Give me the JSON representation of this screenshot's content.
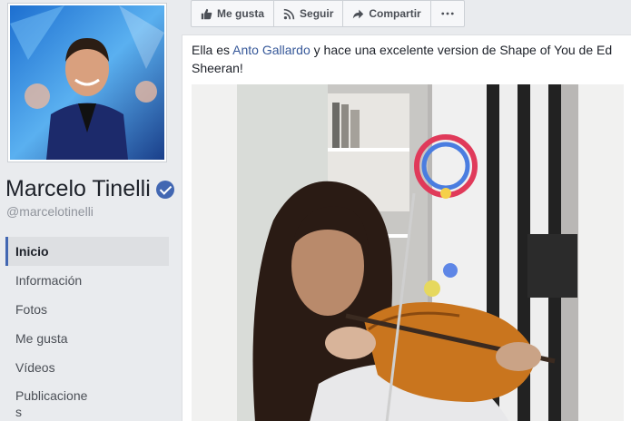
{
  "profile": {
    "name": "Marcelo Tinelli",
    "handle": "@marcelotinelli",
    "verified": true
  },
  "nav": {
    "items": [
      {
        "label": "Inicio",
        "active": true
      },
      {
        "label": "Información",
        "active": false
      },
      {
        "label": "Fotos",
        "active": false
      },
      {
        "label": "Me gusta",
        "active": false
      },
      {
        "label": "Vídeos",
        "active": false
      },
      {
        "label": "Publicaciones",
        "active": false
      }
    ]
  },
  "actions": {
    "like_label": "Me gusta",
    "follow_label": "Seguir",
    "share_label": "Compartir"
  },
  "post": {
    "text_before": "Ella es ",
    "mention": "Anto Gallardo",
    "text_after": " y hace una excelente version de Shape of You de Ed Sheeran!"
  },
  "colors": {
    "brand": "#4267b2",
    "link": "#365899",
    "sidebar_bg": "#e9ebee"
  }
}
